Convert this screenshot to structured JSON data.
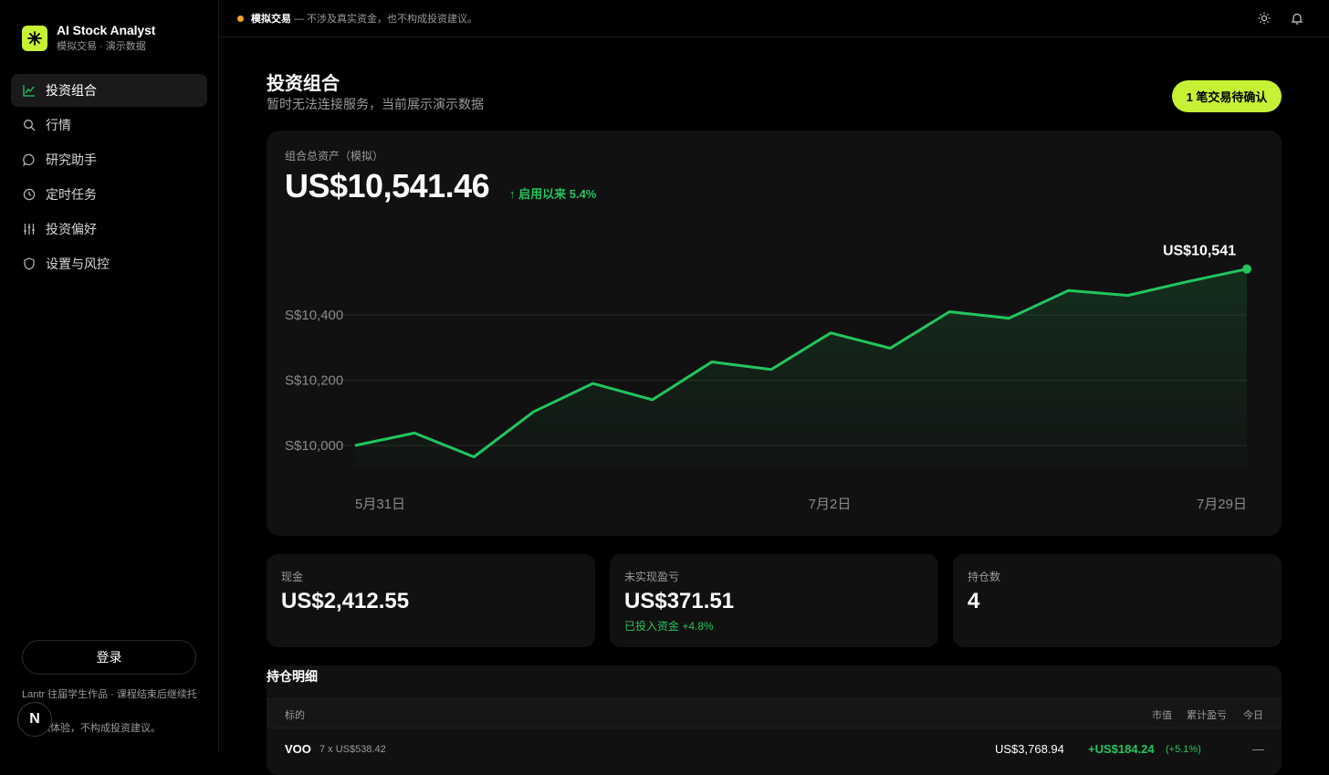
{
  "brand": {
    "title": "AI Stock Analyst",
    "subtitle": "模拟交易 · 演示数据",
    "logo_icon": "sparkle-icon"
  },
  "sidebar": {
    "items": [
      {
        "label": "投资组合",
        "icon": "chart-line-icon",
        "active": true
      },
      {
        "label": "行情",
        "icon": "search-icon",
        "active": false
      },
      {
        "label": "研究助手",
        "icon": "chat-bubble-icon",
        "active": false
      },
      {
        "label": "定时任务",
        "icon": "clock-icon",
        "active": false
      },
      {
        "label": "投资偏好",
        "icon": "sliders-icon",
        "active": false
      },
      {
        "label": "设置与风控",
        "icon": "shield-icon",
        "active": false
      }
    ],
    "login_label": "登录",
    "footer_note": "Lantr 往届学生作品 · 课程结束后继续托",
    "footer_note2": "拟体验，不构成投资建议。",
    "badge_letter": "N"
  },
  "topbar": {
    "mode_label": "模拟交易",
    "notice": "— 不涉及真实资金，也不构成投资建议。",
    "icons": [
      "sun-icon",
      "bell-icon"
    ]
  },
  "main": {
    "title": "投资组合",
    "subtitle": "暂时无法连接服务，当前展示演示数据",
    "pending_button": "1 笔交易待确认"
  },
  "portfolio": {
    "total_label": "组合总资产（模拟）",
    "total_value": "US$10,541.46",
    "change_label": "↑ 启用以来 5.4%",
    "last_value_label": "US$10,541"
  },
  "chart_data": {
    "type": "area",
    "x": [
      "5月31日",
      "",
      "",
      "",
      "",
      "",
      "",
      "",
      "7月2日",
      "",
      "",
      "",
      "",
      "",
      "",
      "7月29日"
    ],
    "values": [
      10000,
      10038,
      9965,
      10103,
      10190,
      10140,
      10256,
      10233,
      10345,
      10298,
      10410,
      10390,
      10475,
      10460,
      10502,
      10541
    ],
    "x_ticks": [
      "5月31日",
      "7月2日",
      "7月29日"
    ],
    "y_ticks": [
      "S$10,000",
      "S$10,200",
      "S$10,400"
    ],
    "y_tick_values": [
      10000,
      10200,
      10400
    ],
    "ylim": [
      9930,
      10610
    ],
    "line_color": "#22c55e",
    "grid": true
  },
  "stats": [
    {
      "label": "现金",
      "value": "US$2,412.55",
      "note": ""
    },
    {
      "label": "未实现盈亏",
      "value": "US$371.51",
      "note": "已投入资金 +4.8%"
    },
    {
      "label": "持仓数",
      "value": "4",
      "note": ""
    }
  ],
  "holdings": {
    "title": "持仓明细",
    "headers": {
      "symbol": "标的",
      "market_value": "市值",
      "pnl": "累计盈亏",
      "today": "今日"
    },
    "rows": [
      {
        "symbol": "VOO",
        "detail": "7 x US$538.42",
        "market_value": "US$3,768.94",
        "pnl": "+US$184.24",
        "pnl_pct": "(+5.1%)",
        "today": "—"
      }
    ]
  }
}
